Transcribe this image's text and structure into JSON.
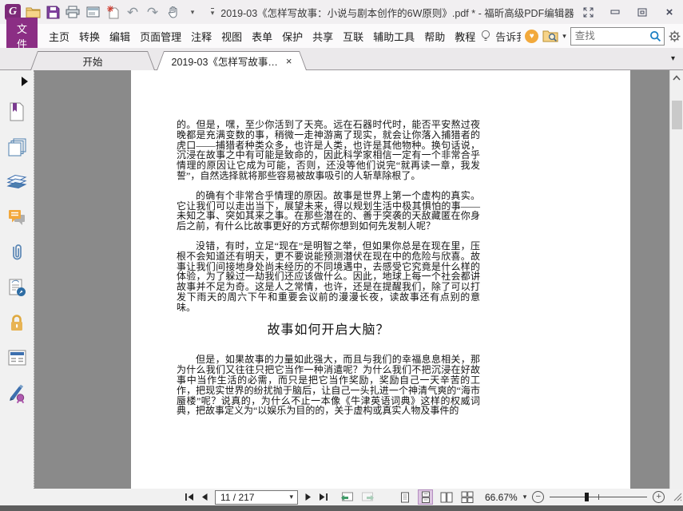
{
  "titlebar": {
    "title": "2019-03《怎样写故事：小说与剧本创作的6W原则》.pdf * - 福昕高级PDF编辑器",
    "logo_letter": "G"
  },
  "menubar": {
    "file": "文件",
    "items": [
      "主页",
      "转换",
      "编辑",
      "页面管理",
      "注释",
      "视图",
      "表单",
      "保护",
      "共享",
      "互联",
      "辅助工具",
      "帮助",
      "教程"
    ],
    "tell_me": "告诉我",
    "search_placeholder": "查找"
  },
  "tabs": {
    "start": "开始",
    "document": "2019-03《怎样写故事…"
  },
  "document": {
    "p1": "的。但是，嘿，至少你活到了天亮。远在石器时代时，能否平安熬过夜晚都是充满变数的事，稍微一走神游离了现实，就会让你落入捕猎者的虎口——捕猎者种类众多，也许是人类，也许是其他物种。换句话说，沉浸在故事之中有可能是致命的，因此科学家相信一定有一个非常合乎情理的原因让它成为可能，否则，还没等他们说完“就再读一章，我发誓”，自然选择就将那些容易被故事吸引的人斩草除根了。",
    "p2": "的确有个非常合乎情理的原因。故事是世界上第一个虚构的真实。它让我们可以走出当下，展望未来，得以规划生活中极其惧怕的事——未知之事、突如其来之事。在那些潜在的、善于突袭的天敌藏匿在你身后之前，有什么比故事更好的方式帮你想到如何先发制人呢？",
    "p3": "没错，有时，立足“现在”是明智之举，但如果你总是在现在里，压根不会知道还有明天，更不要说能预测潜伏在现在中的危险与欣喜。故事让我们间接地身处尚未经历的不同境遇中，去感受它究竟是什么样的体验，为了躲过一劫我们还应该做什么。因此，地球上每一个社会都讲故事并不足为奇。这是人之常情，也许，还是在提醒我们，除了可以打发下雨天的周六下午和重要会议前的漫漫长夜，读故事还有点别的意味。",
    "heading": "故事如何开启大脑？",
    "p4": "但是，如果故事的力量如此强大，而且与我们的幸福息息相关，那为什么我们又往往只把它当作一种消遣呢？为什么我们不把沉浸在好故事中当作生活的必需，而只是把它当作奖励，奖励自己一天辛苦的工作，把现实世界的纷扰抛于脑后，让自己一头扎进一个神清气爽的“海市蜃楼”呢？说真的，为什么不止一本像《牛津英语词典》这样的权威词典，把故事定义为“以娱乐为目的的，关于虚构或真实人物及事件的"
  },
  "statusbar": {
    "page": "11 / 217",
    "zoom": "66.67%"
  },
  "glyphs": {
    "dropdown": "▾",
    "close": "×",
    "heart": "♥",
    "undo": "↶",
    "redo": "↷",
    "minus": "−",
    "plus": "+"
  },
  "colors": {
    "accent": "#8b2e84",
    "doc_background": "#8a8a8a",
    "active_layout_highlight": "#ddc7e1"
  }
}
